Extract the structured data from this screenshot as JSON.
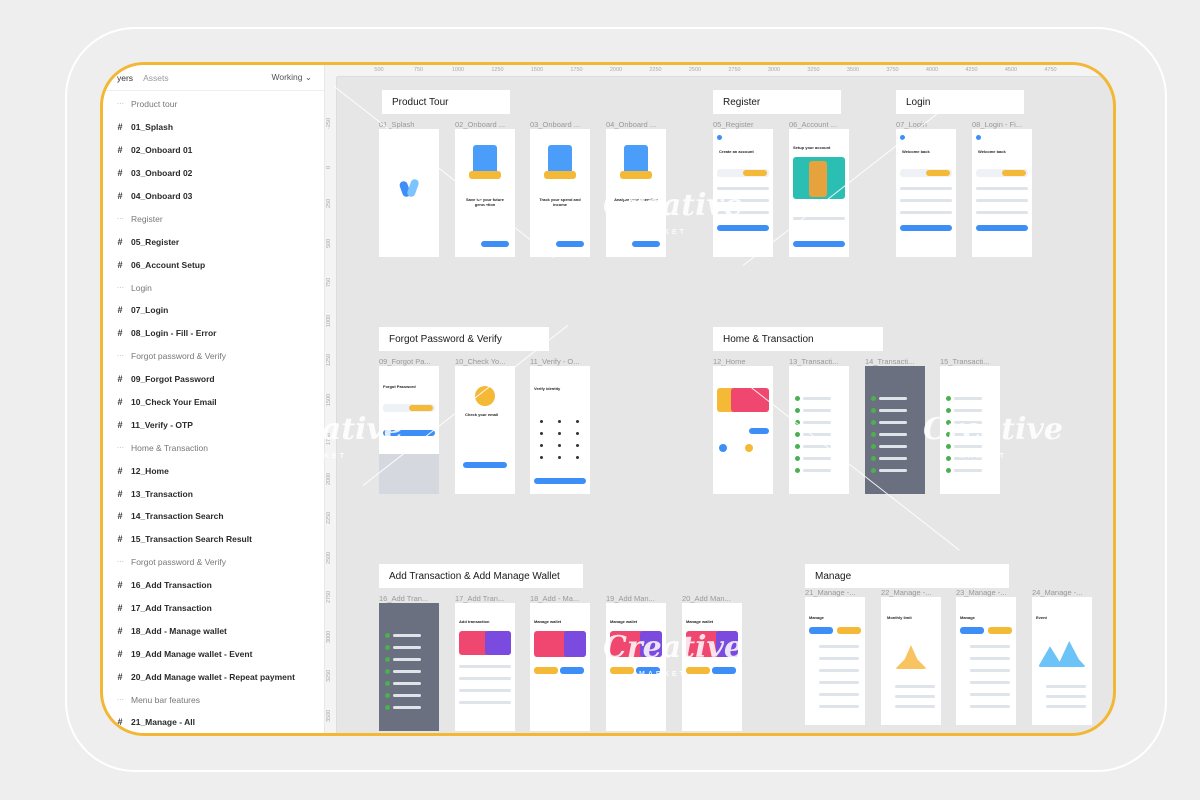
{
  "sidebar": {
    "tabs": [
      "yers",
      "Assets"
    ],
    "working": "Working",
    "layers": [
      {
        "label": "Product tour",
        "kind": "section"
      },
      {
        "label": "01_Splash",
        "kind": "frame"
      },
      {
        "label": "02_Onboard 01",
        "kind": "frame"
      },
      {
        "label": "03_Onboard 02",
        "kind": "frame"
      },
      {
        "label": "04_Onboard 03",
        "kind": "frame"
      },
      {
        "label": "Register",
        "kind": "section"
      },
      {
        "label": "05_Register",
        "kind": "frame"
      },
      {
        "label": "06_Account Setup",
        "kind": "frame"
      },
      {
        "label": "Login",
        "kind": "section"
      },
      {
        "label": "07_Login",
        "kind": "frame"
      },
      {
        "label": "08_Login - Fill - Error",
        "kind": "frame"
      },
      {
        "label": "Forgot password & Verify",
        "kind": "section"
      },
      {
        "label": "09_Forgot Password",
        "kind": "frame"
      },
      {
        "label": "10_Check Your Email",
        "kind": "frame"
      },
      {
        "label": "11_Verify - OTP",
        "kind": "frame"
      },
      {
        "label": "Home & Transaction",
        "kind": "section"
      },
      {
        "label": "12_Home",
        "kind": "frame"
      },
      {
        "label": "13_Transaction",
        "kind": "frame"
      },
      {
        "label": "14_Transaction Search",
        "kind": "frame"
      },
      {
        "label": "15_Transaction Search Result",
        "kind": "frame"
      },
      {
        "label": "Forgot password & Verify",
        "kind": "section"
      },
      {
        "label": "16_Add Transaction",
        "kind": "frame"
      },
      {
        "label": "17_Add Transaction",
        "kind": "frame"
      },
      {
        "label": "18_Add - Manage wallet",
        "kind": "frame"
      },
      {
        "label": "19_Add Manage wallet - Event",
        "kind": "frame"
      },
      {
        "label": "20_Add Manage wallet - Repeat payment",
        "kind": "frame"
      },
      {
        "label": "Menu bar features",
        "kind": "section"
      },
      {
        "label": "21_Manage - All",
        "kind": "frame"
      }
    ]
  },
  "ruler": {
    "top": [
      "500",
      "750",
      "1000",
      "1250",
      "1500",
      "1750",
      "2000",
      "2250",
      "2500",
      "2750",
      "3000",
      "3250",
      "3500",
      "3750",
      "4000",
      "4250",
      "4500",
      "4750"
    ],
    "left": [
      "-250",
      "0",
      "250",
      "500",
      "750",
      "1000",
      "1250",
      "1500",
      "1750",
      "2000",
      "2250",
      "2500",
      "2750",
      "3000",
      "3250",
      "3500"
    ]
  },
  "sections": [
    {
      "title": "Product Tour"
    },
    {
      "title": "Register"
    },
    {
      "title": "Login"
    },
    {
      "title": "Forgot Password & Verify"
    },
    {
      "title": "Home & Transaction"
    },
    {
      "title": "Add Transaction & Add Manage Wallet"
    },
    {
      "title": "Manage"
    }
  ],
  "frames": [
    "01_Splash",
    "02_Onboard ...",
    "03_Onboard ...",
    "04_Onboard ...",
    "05_Register",
    "06_Account ...",
    "07_Login",
    "08_Login - Fi...",
    "09_Forgot Pa...",
    "10_Check Yo...",
    "11_Verify - O...",
    "12_Home",
    "13_Transacti...",
    "14_Transacti...",
    "15_Transacti...",
    "16_Add Tran...",
    "17_Add Tran...",
    "18_Add - Ma...",
    "19_Add Man...",
    "20_Add Man...",
    "21_Manage -...",
    "22_Manage -...",
    "23_Manage -...",
    "24_Manage -..."
  ],
  "screen_texts": {
    "onboard1": "Save for your future generation",
    "onboard2": "Track your spend and income",
    "onboard3": "Analyze your spending",
    "register": "Create an account",
    "account": "Setup your account",
    "login": "Welcome back",
    "forgot": "Forgot Password",
    "check": "Check your email",
    "verify": "Verify identity",
    "add_tx": "Add transaction",
    "manage_wallet": "Manage wallet",
    "manage": "Manage",
    "monthly": "Monthly limit",
    "event": "Event"
  },
  "watermark": {
    "word": "Creative",
    "sub": "MARKET"
  },
  "colors": {
    "accent_frame": "#f3b733",
    "primary": "#3d8ef7"
  }
}
